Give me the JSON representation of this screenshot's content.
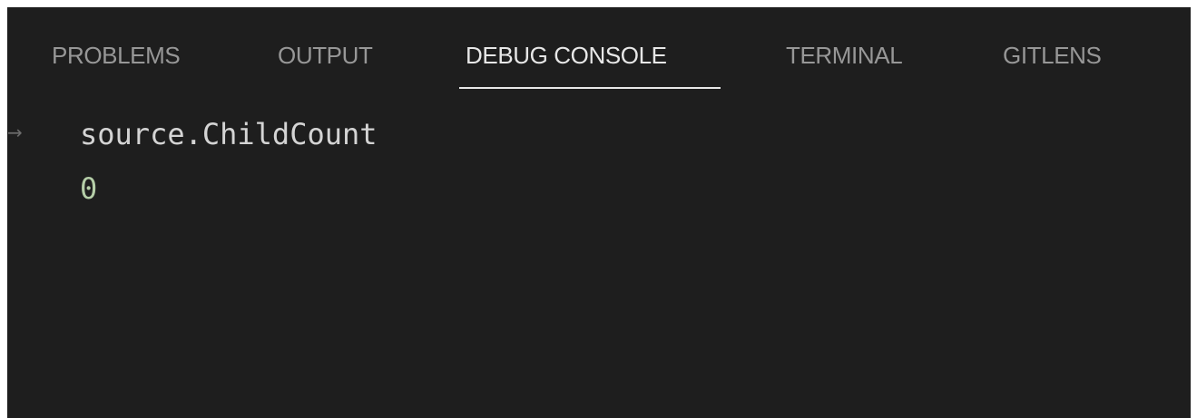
{
  "tabs": [
    {
      "label": "PROBLEMS",
      "active": false
    },
    {
      "label": "OUTPUT",
      "active": false
    },
    {
      "label": "DEBUG CONSOLE",
      "active": true
    },
    {
      "label": "TERMINAL",
      "active": false
    },
    {
      "label": "GITLENS",
      "active": false
    }
  ],
  "console": {
    "entries": [
      {
        "kind": "input",
        "prompt_icon": "arrow-right-icon",
        "prompt_glyph": "→",
        "text": "source.ChildCount"
      },
      {
        "kind": "result",
        "text": "0",
        "color": "#b5cea8"
      }
    ]
  },
  "colors": {
    "panel_background": "#1e1e1e",
    "active_tab": "#e7e7e7",
    "inactive_tab": "#979797",
    "numeric_result": "#b5cea8"
  }
}
